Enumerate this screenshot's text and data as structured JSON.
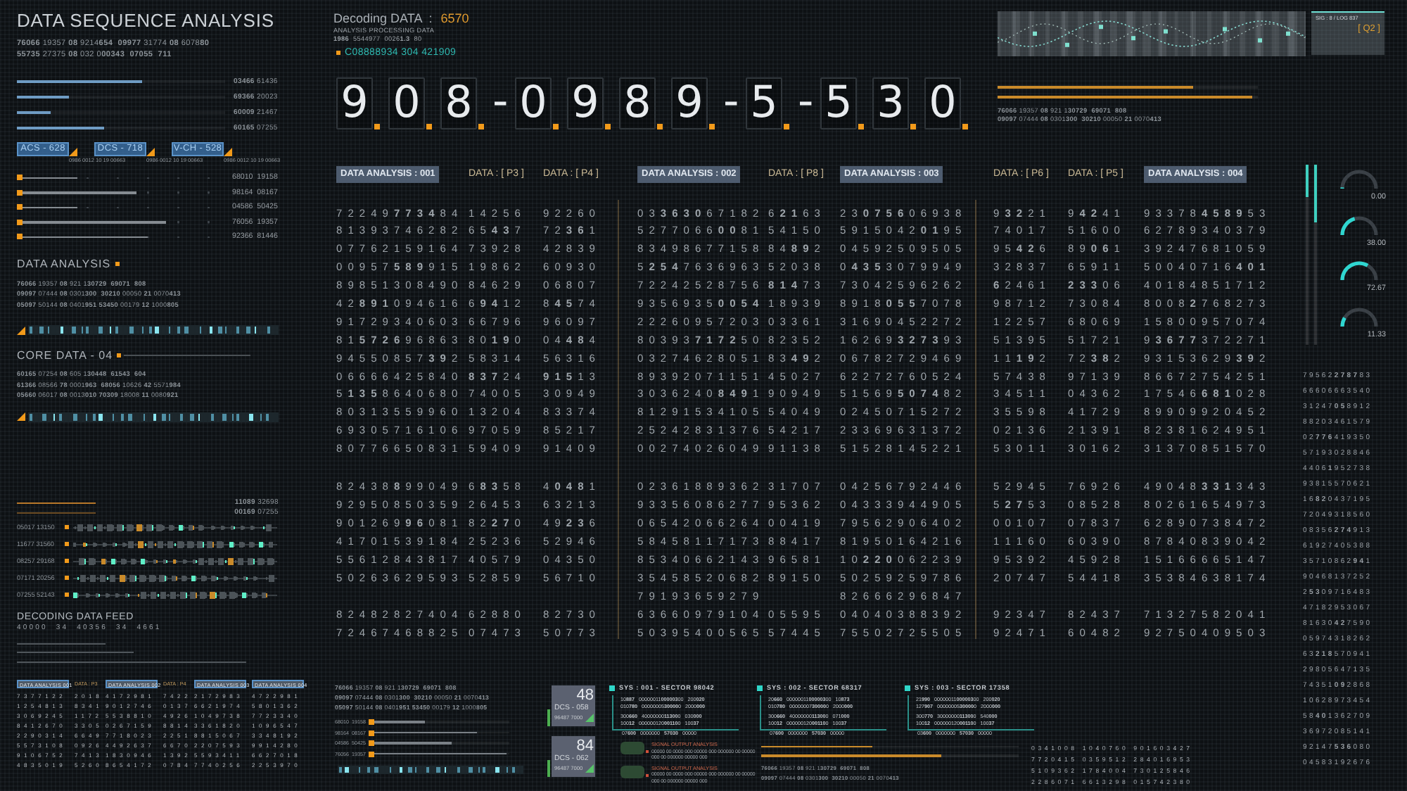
{
  "left_panel": {
    "title": "DATA SEQUENCE ANALYSIS",
    "code_lines": [
      "**76066** 19357 **08** 9214**654**  **09977** 31774 **08** 6078**80**",
      "**55735** 27375 **08** 032 0**00343**  **07055  711**"
    ],
    "bars": [
      {
        "level": 0.6,
        "reading": "**03466** 61436"
      },
      {
        "level": 0.25,
        "reading": "**69366** 20023"
      },
      {
        "level": 0.16,
        "reading": "**60009** 21467"
      },
      {
        "level": 0.42,
        "reading": "**60165** 07255"
      }
    ],
    "tags": [
      {
        "label": "ACS - 628",
        "caption": "0986 0012 10 19 00663"
      },
      {
        "label": "DCS - 718",
        "caption": "0986 0012 10 19 00663"
      },
      {
        "label": "V-CH - 528",
        "caption": "0986 0012 10 19 00663"
      }
    ],
    "sliders": [
      {
        "level": 0.27,
        "reading": "68010  19158"
      },
      {
        "level": 0.56,
        "reading": "98164  08167"
      },
      {
        "level": 0.27,
        "reading": "04586  50425"
      },
      {
        "level": 0.71,
        "reading": "76056  19357"
      },
      {
        "level": 0.62,
        "reading": "92366  81446"
      }
    ],
    "data_analysis": {
      "heading": "DATA ANALYSIS",
      "lines": [
        "**76066** 19357 **08** 921 1**30729  69071  808**",
        "**09097** 07444 **08** 0301**300  30210** 00050 **21** 0070**413**",
        "**05097** 50144 **08** 0401**951 53450** 00179 **12** 1000**805**"
      ]
    },
    "core_data": {
      "heading": "CORE DATA - 04",
      "lines": [
        "**60165** 07254 **08** 605 1**30448  61543  604**",
        "**61366** 08566 **78** 0001**963  68056** 10626 **42** 5571**984**",
        "**05660** 06017 **08** 0013**010 70309** 18008 **11** 0080**921**"
      ]
    },
    "readouts": [
      "**11089** 32698",
      "**00169** 07255"
    ],
    "signal_rows": [
      "05017 13150",
      "11677 31560",
      "08257 29168",
      "07171 20256",
      "07255 52143"
    ],
    "feed": {
      "heading": "DECODING DATA FEED",
      "code": "40000  34  40356  34  4661"
    },
    "mini_grid": {
      "headers": [
        {
          "label": "DATA ANALYSIS 001",
          "kind": "tag"
        },
        {
          "label": "DATA : P3",
          "kind": "plain"
        },
        {
          "label": "DATA ANALYSIS 002",
          "kind": "tag"
        },
        {
          "label": "DATA : P4",
          "kind": "plain"
        },
        {
          "label": "DATA ANALYSIS 003",
          "kind": "tag"
        },
        {
          "label": "DATA ANALYSIS 004",
          "kind": "tag"
        }
      ],
      "rows": [
        [
          "7377122",
          "2018",
          "4172981",
          "7422",
          "2172983",
          "4722981"
        ],
        [
          "1254813",
          "8341",
          "9012746",
          "0137",
          "6621974",
          "5801362"
        ],
        [
          "3069245",
          "1172",
          "5538810",
          "4926",
          "1049738",
          "7723340"
        ],
        [
          "8412670",
          "3305",
          "0267159",
          "8814",
          "3361820",
          "1096547"
        ],
        [
          "2290314",
          "6649",
          "7718023",
          "2251",
          "8815067",
          "3348192"
        ],
        [
          "5573108",
          "0926",
          "4492637",
          "6670",
          "2207593",
          "9914280"
        ],
        [
          "9106752",
          "7413",
          "1830946",
          "1392",
          "5593411",
          "6627018"
        ],
        [
          "4835019",
          "5260",
          "8654172",
          "0784",
          "7740256",
          "2253970"
        ]
      ]
    }
  },
  "decoder": {
    "title": "Decoding DATA  :",
    "value": "6570",
    "subtitle": "ANALYSIS PROCESSING DATA",
    "code": "**1986**  5544977  0026**1.3**  80",
    "id": "C08888934 304 421909"
  },
  "display": [
    {
      "kind": "digit",
      "char": "9"
    },
    {
      "kind": "digit",
      "char": "0"
    },
    {
      "kind": "digit",
      "char": "8"
    },
    {
      "kind": "separator",
      "char": "-"
    },
    {
      "kind": "digit",
      "char": "0"
    },
    {
      "kind": "digit",
      "char": "9"
    },
    {
      "kind": "digit",
      "char": "8"
    },
    {
      "kind": "digit",
      "char": "9"
    },
    {
      "kind": "separator",
      "char": "-"
    },
    {
      "kind": "digit",
      "char": "5"
    },
    {
      "kind": "separator",
      "char": "-"
    },
    {
      "kind": "digit",
      "char": "5"
    },
    {
      "kind": "digit",
      "char": "3"
    },
    {
      "kind": "digit",
      "char": "0"
    }
  ],
  "top_right": {
    "status": {
      "text": "SIG : 8 / LOG 837",
      "code": "[ Q2 ]"
    },
    "progress": [
      {
        "level": 0.75
      },
      {
        "level": 0.98
      }
    ],
    "lines": [
      "**76066** 19357 **08** 921 1**30729  69071  808**",
      "**09097** 07444 **08** 0301**300  30210** 00050 **21** 0070**413**"
    ]
  },
  "grid": {
    "headers": [
      {
        "label": "DATA ANALYSIS : 001",
        "kind": "tag"
      },
      {
        "label": "DATA : [ P3 ]",
        "kind": "plain"
      },
      {
        "label": "DATA : [ P4 ]",
        "kind": "plain"
      },
      {
        "label": "DATA ANALYSIS : 002",
        "kind": "tag"
      },
      {
        "label": "DATA : [ P8 ]",
        "kind": "plain"
      },
      {
        "label": "DATA ANALYSIS : 003",
        "kind": "tag"
      },
      {
        "label": "DATA : [ P6 ]",
        "kind": "plain"
      },
      {
        "label": "DATA : [ P5 ]",
        "kind": "plain"
      },
      {
        "label": "DATA ANALYSIS : 004",
        "kind": "tag"
      }
    ],
    "blocks": [
      [
        {
          "a001": "7 2 2 4 9 **7 7 3 4** 8 4",
          "p3": "1 4 2 5 6",
          "p4": "9 2 2 6 0",
          "a002": "0 3 **3 6 3 0** 6 7 1 8 2",
          "p8": "6 **2 1** 6 3",
          "a003": "2 3 **0 7 5 6** 0 6 9 3 8",
          "p6": "9 **3 2** 2 1",
          "p5": "9 **4 2** 4 1",
          "a004": "9 3 3 7 8 **4 5 8 9** 5 3"
        },
        {
          "a001": "8 1 3 9 3 7 4 6 2 8 2",
          "p3": "6 5 **4 3** 7",
          "p4": "7 2 **3 6** 1",
          "a002": "5 2 7 7 0 6 6 **0 0** 8 1",
          "p8": "5 4 1 5 0",
          "a003": "5 9 1 5 0 4 2 **0 1** 9 5",
          "p6": "7 4 0 1 7",
          "p5": "5 1 6 0 0",
          "a004": "6 2 7 8 9 3 4 0 3 7 9"
        },
        {
          "a001": "0 7 7 6 2 1 5 9 1 6 4",
          "p3": "7 3 9 2 8",
          "p4": "4 2 8 3 9",
          "a002": "8 3 4 9 8 6 7 7 1 5 8",
          "p8": "8 4 **8 9** 2",
          "a003": "0 4 5 9 2 5 0 9 5 0 5",
          "p6": "9 5 **4 2** 6",
          "p5": "8 9 **0 6** 1",
          "a004": "3 9 2 4 7 6 8 1 0 5 9"
        },
        {
          "a001": "0 0 9 5 7 **5 8 9** 9 1 5",
          "p3": "1 9 8 6 2",
          "p4": "6 0 9 3 0",
          "a002": "5 **2 5 4** 7 6 3 6 9 6 3",
          "p8": "5 2 0 3 8",
          "a003": "0 **4 3 5** 3 0 7 9 9 4 9",
          "p6": "3 2 8 3 7",
          "p5": "6 5 9 1 1",
          "a004": "5 0 0 4 0 7 1 6 **4 0 1**"
        },
        {
          "a001": "8 9 8 5 1 3 0 8 4 9 0",
          "p3": "8 4 6 2 9",
          "p4": "0 6 8 0 7",
          "a002": "7 2 2 4 2 5 2 8 7 5 6",
          "p8": "**8 1 4** 7 3",
          "a003": "7 3 0 4 2 5 9 6 2 6 2",
          "p6": "**6** 2 4 6 1",
          "p5": "**2 3 3** 0 6",
          "a004": "4 0 1 8 4 8 5 1 7 1 2"
        },
        {
          "a001": "4 2 **8 9 1** 0 9 4 6 1 6",
          "p3": "6 **9 4** 1 2",
          "p4": "8 **4 5** 7 4",
          "a002": "9 3 5 6 9 3 5 **0 0 5 4**",
          "p8": "1 8 9 3 9",
          "a003": "8 9 1 8 **0 5 5** 7 0 7 8",
          "p6": "9 8 7 1 2",
          "p5": "7 3 0 8 4",
          "a004": "8 0 0 8 **2** 7 6 8 2 7 3"
        },
        {
          "a001": "9 1 7 2 9 3 4 0 6 0 3",
          "p3": "6 6 7 9 6",
          "p4": "9 6 0 9 7",
          "a002": "2 2 2 6 0 9 5 7 2 0 3",
          "p8": "0 3 3 6 1",
          "a003": "3 1 6 9 0 4 5 2 2 7 2",
          "p6": "1 2 2 5 7",
          "p5": "6 8 0 6 9",
          "a004": "1 5 8 0 0 9 5 7 0 7 4"
        },
        {
          "a001": "8 1 **5 7 2 6** 9 6 8 6 3",
          "p3": "8 0 **1 9** 0",
          "p4": "0 4 **4 8** 4",
          "a002": "8 0 3 9 3 **7 1 7 2** 5 0",
          "p8": "8 2 3 5 2",
          "a003": "1 6 2 6 9 **3 2 7 3** 9 3",
          "p6": "5 1 3 9 5",
          "p5": "5 1 7 2 1",
          "a004": "9 **3 6 7 7** 3 7 2 2 7 1"
        },
        {
          "a001": "9 4 5 5 0 8 5 7 **3 9** 2",
          "p3": "5 8 3 1 4",
          "p4": "5 6 3 1 6",
          "a002": "0 3 2 7 4 6 2 8 0 5 1",
          "p8": "8 3 **4 9** 2",
          "a003": "0 6 7 8 2 7 2 9 4 6 9",
          "p6": "1 1 **1 9** 2",
          "p5": "7 2 **3 8** 2",
          "a004": "9 3 1 5 3 6 2 9 **3 9** 2"
        },
        {
          "a001": "0 6 6 6 6 4 2 5 8 4 0",
          "p3": "**8 3 7** 2 4",
          "p4": "**9 1 5** 1 3",
          "a002": "8 9 3 9 2 0 7 1 1 5 1",
          "p8": "4 5 0 2 7",
          "a003": "6 2 2 7 2 7 6 0 5 2 4",
          "p6": "5 7 4 3 8",
          "p5": "9 7 1 3 9",
          "a004": "8 6 6 7 2 7 5 4 2 5 1"
        },
        {
          "a001": "5 **1 3 5** 8 6 4 0 6 8 0",
          "p3": "7 4 0 0 5",
          "p4": "3 0 9 4 9",
          "a002": "3 0 3 6 2 4 0 **8 4 9** 1",
          "p8": "9 0 9 4 9",
          "a003": "5 1 5 6 9 **5 0 7 4** 8 2",
          "p6": "3 4 5 1 1",
          "p5": "0 4 3 6 2",
          "a004": "1 7 5 4 6 **6 8 1** 0 2 8"
        },
        {
          "a001": "8 0 3 1 3 5 5 9 9 6 0",
          "p3": "1 3 2 0 4",
          "p4": "8 3 3 7 4",
          "a002": "8 1 2 9 1 5 3 4 1 0 5",
          "p8": "5 4 0 4 9",
          "a003": "0 2 4 5 0 7 1 5 2 7 2",
          "p6": "3 5 5 9 8",
          "p5": "4 1 7 2 9",
          "a004": "8 9 9 0 9 9 2 0 4 5 2"
        },
        {
          "a001": "6 9 3 0 5 7 1 6 1 0 6",
          "p3": "9 7 0 5 9",
          "p4": "8 5 2 1 7",
          "a002": "2 5 2 4 2 8 3 1 3 7 6",
          "p8": "5 4 2 1 7",
          "a003": "2 3 3 6 9 6 3 1 3 7 2",
          "p6": "0 2 1 3 6",
          "p5": "2 1 3 9 1",
          "a004": "8 2 3 8 1 6 2 4 9 5 1"
        },
        {
          "a001": "8 0 7 7 6 6 5 0 8 3 1",
          "p3": "5 9 4 0 9",
          "p4": "9 1 4 0 9",
          "a002": "0 0 2 7 4 0 2 6 0 4 9",
          "p8": "9 1 1 3 8",
          "a003": "5 1 5 2 8 1 4 5 2 2 1",
          "p6": "5 3 0 1 1",
          "p5": "3 0 1 6 2",
          "a004": "3 1 3 7 0 8 5 1 5 7 0"
        }
      ],
      [
        {
          "a001": "8 2 4 3 8 **8** 9 9 0 4 9",
          "p3": "6 **8 3** 5 8",
          "p4": "4 **0 4 8** 1",
          "a002": "0 2 3 6 1 8 8 9 3 6 2",
          "p8": "3 1 7 0 7",
          "a003": "0 4 2 5 6 7 9 2 4 4 6",
          "p6": "5 2 9 4 5",
          "p5": "7 6 9 2 6",
          "a004": "4 9 0 4 8 **3 3 1** 3 4 3"
        },
        {
          "a001": "9 2 9 5 0 8 5 0 3 5 9",
          "p3": "2 6 4 5 3",
          "p4": "6 3 2 1 3",
          "a002": "9 3 3 5 6 0 8 6 2 7 7",
          "p8": "9 5 3 6 2",
          "a003": "0 4 3 3 3 9 4 4 9 0 5",
          "p6": "5 **2 7** 5 3",
          "p5": "0 8 5 2 8",
          "a004": "8 0 2 6 1 6 5 4 9 7 3"
        },
        {
          "a001": "9 0 1 2 6 9 **9 6** 0 8 1",
          "p3": "8 2 **2 7** 0",
          "p4": "4 9 **2 3** 6",
          "a002": "0 6 5 4 2 0 6 6 2 6 4",
          "p8": "0 0 4 1 9",
          "a003": "7 9 5 6 2 9 0 6 4 0 2",
          "p6": "0 0 1 0 7",
          "p5": "0 7 8 3 7",
          "a004": "6 2 8 9 0 7 3 8 4 7 2"
        },
        {
          "a001": "4 1 7 0 1 5 3 9 1 8 4",
          "p3": "2 5 2 3 6",
          "p4": "5 2 9 4 6",
          "a002": "5 8 4 5 8 1 1 7 1 7 3",
          "p8": "8 8 4 1 7",
          "a003": "8 1 9 5 0 1 6 4 2 1 6",
          "p6": "1 1 1 6 0",
          "p5": "6 0 3 9 0",
          "a004": "8 7 8 4 0 8 3 9 0 4 2"
        },
        {
          "a001": "5 5 6 1 2 8 4 3 8 1 7",
          "p3": "4 0 5 7 9",
          "p4": "0 4 3 5 0",
          "a002": "8 5 3 4 0 6 6 2 1 4 3",
          "p8": "9 6 5 8 1",
          "a003": "1 0 **2 2 0** 0 6 2 2 3 9",
          "p6": "9 5 3 9 2",
          "p5": "4 5 9 2 8",
          "a004": "1 5 1 6 6 6 6 5 1 4 7"
        },
        {
          "a001": "5 0 2 6 3 6 2 9 5 9 3",
          "p3": "5 2 8 5 9",
          "p4": "5 6 7 1 0",
          "a002": "3 5 4 5 8 5 2 0 6 8 2",
          "p8": "8 9 1 5 0",
          "a003": "5 0 2 5 9 2 5 9 7 8 6",
          "p6": "2 0 7 4 7",
          "p5": "5 4 4 1 8",
          "a004": "3 5 3 8 4 6 3 8 1 7 4"
        },
        {
          "a002": "7 9 1 9 3 6 5 9 2 7 9",
          "a003": "8 2 6 6 6 2 9 6 8 4 7"
        },
        {
          "a001": "8 2 4 8 2 8 2 7 4 0 4",
          "p3": "6 2 8 8 0",
          "p4": "8 2 7 3 0",
          "a002": "6 3 6 6 0 9 7 9 1 0 4",
          "p8": "0 5 5 9 5",
          "a003": "0 4 0 4 0 3 8 8 3 9 2",
          "p6": "9 2 3 4 7",
          "p5": "8 2 4 3 7",
          "a004": "7 1 3 2 7 5 8 2 0 4 1"
        },
        {
          "a001": "7 2 4 6 7 4 6 8 8 2 5",
          "p3": "0 7 4 7 3",
          "p4": "5 0 7 7 3",
          "a002": "5 0 3 9 5 4 0 0 5 6 5",
          "p8": "5 7 4 4 5",
          "a003": "7 5 5 0 2 7 2 5 5 0 5",
          "p6": "9 2 4 7 1",
          "p5": "6 0 4 8 2",
          "a004": "9 2 7 5 0 4 0 9 5 0 3"
        }
      ]
    ]
  },
  "meters": [
    {
      "level": 0.18
    },
    {
      "level": 0.32
    }
  ],
  "gauges": [
    {
      "reading": "0.00",
      "level": 0.0
    },
    {
      "reading": "38.00",
      "level": 0.38
    },
    {
      "reading": "72.67",
      "level": 0.7267
    },
    {
      "reading": "11.33",
      "level": 0.1133
    }
  ],
  "digit_strip": [
    "7 9 5 6 2 **2 7 8 7** 8 3",
    "6 6 6 0 6 6 6 3 5 4 0",
    "3 1 2 4 7 **0 5** 8 9 1 2",
    "8 8 2 0 3 4 6 1 5 7 9",
    "0 2 **7 7 6** 4 1 9 3 5 0",
    "5 7 1 9 3 0 2 8 8 4 6",
    "4 4 0 6 **1** 9 5 2 7 3 8",
    "9 3 8 1 5 5 7 0 6 2 1",
    "1 6 **8 2** 0 4 3 7 1 9 5",
    "7 2 0 4 9 3 1 8 5 6 0",
    "0 8 3 5 6 **2 7 4** 9 1 3",
    "6 1 9 2 7 4 0 5 3 8 8",
    "3 5 7 1 0 8 6 2 **9 4** 1",
    "9 0 4 6 8 1 3 7 2 5 2",
    "2 **5 3** 0 9 7 1 6 4 8 3",
    "4 7 1 8 2 9 5 3 0 6 7",
    "8 1 6 3 0 **4 2** 7 5 9 0",
    "0 5 9 7 4 3 1 8 2 6 2",
    "6 3 **2 1 8** 5 7 0 9 4 1",
    "2 9 8 0 5 6 4 7 1 3 5",
    "7 4 3 5 1 **0 9** 2 8 6 8",
    "1 0 6 2 8 9 7 3 4 5 4",
    "5 8 **4 0** 1 3 6 2 7 0 9",
    "3 6 9 7 2 0 8 5 1 4 1",
    "9 2 1 4 7 **5 3 6** 0 8 0",
    "0 4 5 8 3 1 9 2 6 7 6"
  ],
  "bottom": {
    "lines": [
      "**76066** 19357 **08** 921 1**30729  69071  808**",
      "**09097** 07444 **08** 0301**300  30210** 00050 **21** 0070**413**",
      "**05097** 50144 **08** 0401**951 53450** 00179 **12** 1000**805**"
    ],
    "sliders": [
      {
        "level": 0.38,
        "reading": "68010  19158"
      },
      {
        "level": 0.76,
        "reading": "98164  08167"
      },
      {
        "level": 0.57,
        "reading": "04586  50425"
      },
      {
        "level": 0.98,
        "reading": "76056  19357"
      }
    ],
    "cards": [
      {
        "value": "48",
        "label": "DCS - 058",
        "caption": "96487 7000"
      },
      {
        "value": "84",
        "label": "DCS - 062",
        "caption": "96487 7000"
      }
    ],
    "sys_panels": [
      {
        "title": "SYS : 001 - SECTOR 98042",
        "rows": [
          "10**887**   00000011**000003**00   200**020**",
          "010**780**   00000005**30000**0   2000**000**",
          "300**660**   40000000**11300**0   030**000**",
          "100**12**   000000120**00110**0   100**37**"
        ],
        "footer": "07**600**   0000000   **57030**   00000"
      },
      {
        "title": "SYS : 002 - SECTOR 68317",
        "rows": [
          "20**660**   00000011**000003**00   10**873**",
          "010**780**   00000007**30000**0   2000**000**",
          "300**660**   40000000**11300**0   071**000**",
          "100**12**   000000120**00110**0   100**37**"
        ],
        "footer": "07**600**   0000000   **57030**   00000"
      },
      {
        "title": "SYS : 003 - SECTOR 17358",
        "rows": [
          "21**990**   00000011**000003**00   200**020**",
          "127**907**   00000005**30000**0   2000**000**",
          "300**770**   30000000**11300**0   540**000**",
          "100**12**   000000120**00110**0   100**37**"
        ],
        "footer": "03**600**   0000000   **57030**   00000"
      }
    ],
    "alerts": [
      {
        "title": "SIGNAL OUTPUT ANALYSIS",
        "lines": [
          "00000 00 0000 000 00000 000 000000 00 00000",
          "000 00 000000 00000 000"
        ]
      },
      {
        "title": "SIGNAL OUTPUT ANALYSIS",
        "lines": [
          "00000 00 0000 000 00000 000 000000 00 00000",
          "000 00 000000 00000 000"
        ]
      }
    ],
    "progress": [
      {
        "level": 0.43
      },
      {
        "level": 0.7
      }
    ],
    "notes": [
      "**76066** 19357 **08** 921 1**30729  69071  808**",
      "**09097** 07444 **08** 0301**300  30210** 00050 **21** 0070**413**"
    ],
    "digit_rows": [
      "0341008 1040760 901603427",
      "7720415 0359512 284016953",
      "5109362 1784004 730125846",
      "2286071 6613298 015742380"
    ]
  }
}
